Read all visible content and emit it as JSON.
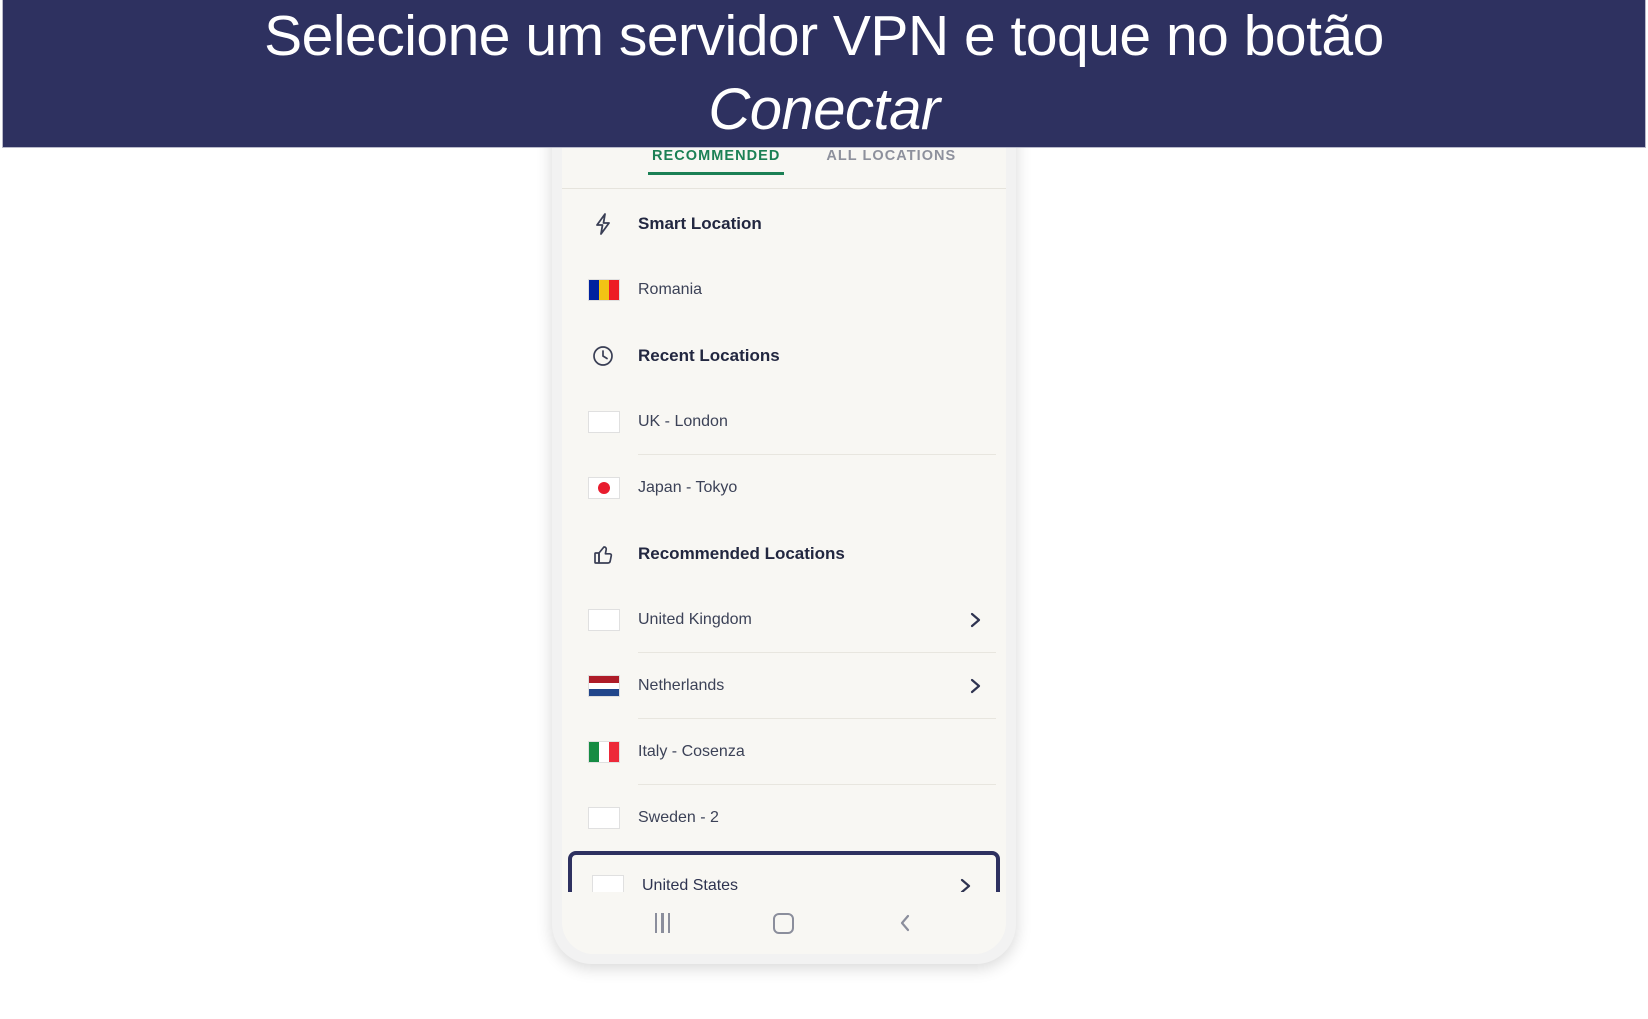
{
  "banner": {
    "line1": "Selecione um servidor VPN e toque no botão",
    "line2": "Conectar",
    "background_color": "#2e3160",
    "text_color": "#ffffff"
  },
  "phone_app": {
    "tabs": [
      {
        "label": "RECOMMENDED",
        "active": true,
        "accent_color": "#1b8055"
      },
      {
        "label": "ALL LOCATIONS",
        "active": false,
        "color": "#8d909c"
      }
    ],
    "sections": [
      {
        "icon": "lightning-bolt-icon",
        "heading": "Smart Location",
        "items": [
          {
            "label": "Romania",
            "flag": "romania-flag",
            "chevron": false,
            "divider": false,
            "highlighted": false
          }
        ]
      },
      {
        "icon": "clock-icon",
        "heading": "Recent Locations",
        "items": [
          {
            "label": "UK - London",
            "flag": "uk-flag",
            "chevron": false,
            "divider": true,
            "highlighted": false
          },
          {
            "label": "Japan - Tokyo",
            "flag": "japan-flag",
            "chevron": false,
            "divider": false,
            "highlighted": false
          }
        ]
      },
      {
        "icon": "thumbs-up-icon",
        "heading": "Recommended Locations",
        "items": [
          {
            "label": "United Kingdom",
            "flag": "uk-flag",
            "chevron": true,
            "divider": true,
            "highlighted": false
          },
          {
            "label": "Netherlands",
            "flag": "netherlands-flag",
            "chevron": true,
            "divider": true,
            "highlighted": false
          },
          {
            "label": "Italy - Cosenza",
            "flag": "italy-flag",
            "chevron": false,
            "divider": true,
            "highlighted": false
          },
          {
            "label": "Sweden - 2",
            "flag": "sweden-flag",
            "chevron": false,
            "divider": false,
            "highlighted": false
          },
          {
            "label": "United States",
            "flag": "usa-flag",
            "chevron": true,
            "divider": false,
            "highlighted": true
          }
        ]
      }
    ],
    "highlight_color": "#2e3160",
    "screen_background": "#f8f7f3"
  },
  "navbar": {
    "recents_label": "recents-icon",
    "home_label": "home-icon",
    "back_label": "back-icon"
  }
}
